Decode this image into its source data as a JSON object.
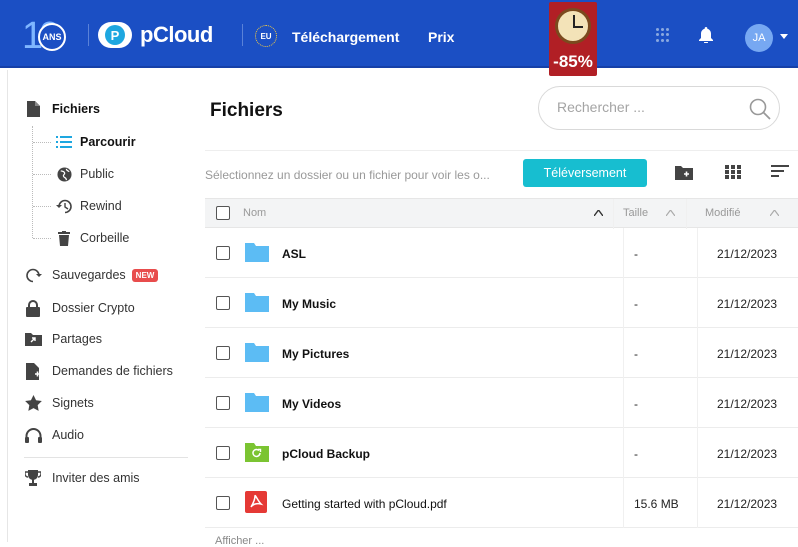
{
  "header": {
    "anniversary_number": "10",
    "anniversary_badge": "ANS",
    "brand_icon_letter": "P",
    "brand_name": "pCloud",
    "eu_badge": "EU",
    "nav": [
      {
        "label": "Téléchargement"
      },
      {
        "label": "Prix"
      }
    ],
    "promo_discount": "-85%",
    "avatar_initials": "JA",
    "colors": {
      "bar": "#1b4fc4",
      "promo": "#b11f25"
    }
  },
  "sidebar": {
    "files_label": "Fichiers",
    "sub_items": [
      {
        "label": "Parcourir",
        "icon": "list-icon"
      },
      {
        "label": "Public",
        "icon": "globe-icon"
      },
      {
        "label": "Rewind",
        "icon": "rewind-icon"
      },
      {
        "label": "Corbeille",
        "icon": "trash-icon"
      }
    ],
    "items": [
      {
        "label": "Sauvegardes",
        "icon": "backup-icon",
        "badge": "NEW"
      },
      {
        "label": "Dossier Crypto",
        "icon": "lock-icon"
      },
      {
        "label": "Partages",
        "icon": "share-icon"
      },
      {
        "label": "Demandes de fichiers",
        "icon": "file-request-icon"
      },
      {
        "label": "Signets",
        "icon": "star-icon"
      },
      {
        "label": "Audio",
        "icon": "headphones-icon"
      }
    ],
    "invite_label": "Inviter des amis"
  },
  "main": {
    "title": "Fichiers",
    "search_placeholder": "Rechercher ...",
    "hint": "Sélectionnez un dossier ou un fichier pour voir les o...",
    "upload_label": "Téléversement",
    "columns": {
      "name": "Nom",
      "size": "Taille",
      "modified": "Modifié"
    },
    "rows": [
      {
        "name": "ASL",
        "size": "-",
        "modified": "21/12/2023",
        "type": "folder"
      },
      {
        "name": "My Music",
        "size": "-",
        "modified": "21/12/2023",
        "type": "folder"
      },
      {
        "name": "My Pictures",
        "size": "-",
        "modified": "21/12/2023",
        "type": "folder"
      },
      {
        "name": "My Videos",
        "size": "-",
        "modified": "21/12/2023",
        "type": "folder"
      },
      {
        "name": "pCloud Backup",
        "size": "-",
        "modified": "21/12/2023",
        "type": "backup-folder"
      },
      {
        "name": "Getting started with pCloud.pdf",
        "size": "15.6 MB",
        "modified": "21/12/2023",
        "type": "pdf"
      }
    ],
    "footer": "Afficher ..."
  }
}
